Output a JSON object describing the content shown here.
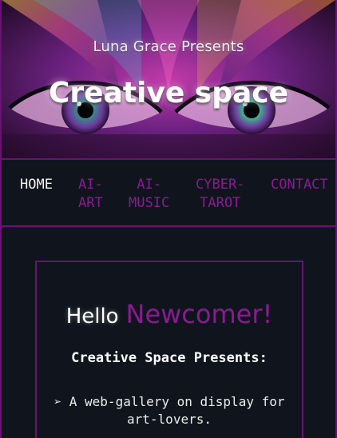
{
  "hero": {
    "subtitle": "Luna Grace Presents",
    "title": "Creative space",
    "image_icon": "decorative-eyes-art"
  },
  "nav": {
    "items": [
      {
        "label": "HOME",
        "active": true
      },
      {
        "label": "AI-\nART",
        "active": false
      },
      {
        "label": "AI-\nMUSIC",
        "active": false
      },
      {
        "label": "CYBER-\nTAROT",
        "active": false
      },
      {
        "label": "CONTACT",
        "active": false
      }
    ]
  },
  "welcome": {
    "hello": "Hello",
    "newcomer": "Newcomer!",
    "presents": "Creative Space Presents:",
    "bullet_icon": "pointer-arrow-icon",
    "bullet_text": "➢ A web-gallery on display for art-lovers."
  },
  "colors": {
    "background": "#10151d",
    "accent": "#8b1a93",
    "border": "#6a1273",
    "text": "#ffffff"
  }
}
